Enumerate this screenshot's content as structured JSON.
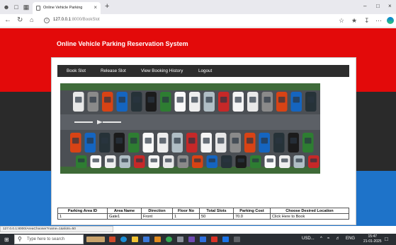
{
  "browser": {
    "tab_title": "Online Vehicle Parking",
    "url_host": "127.0.0.1",
    "url_rest": ":8000/BookSlot"
  },
  "site": {
    "title": "Online Vehicle Parking Reservation System"
  },
  "nav": {
    "items": [
      "Book Slot",
      "Release Slot",
      "View Booking History",
      "Logout"
    ]
  },
  "table": {
    "headers": [
      "Parking Area ID",
      "Area Name",
      "Direction",
      "Floor No",
      "Total Slots",
      "Parking Cost",
      "Choose Desired Location"
    ],
    "rows": [
      [
        "1",
        "Gate1",
        "Front",
        "1",
        "50",
        "70.0",
        "Click Here to Book"
      ]
    ]
  },
  "status_bar": {
    "url": "127.0.0.1:8000/AreaChooser?name=1&slots=50"
  },
  "taskbar": {
    "search_placeholder": "Type here to search",
    "weather": "USD...",
    "lang": "ENG",
    "time": "15:47",
    "date": "21-01-2025"
  },
  "colors": {
    "header_red": "#e30a0a",
    "band_dark": "#2a2a2a",
    "band_blue": "#1e73c9",
    "navbar": "#2d2d2d"
  }
}
